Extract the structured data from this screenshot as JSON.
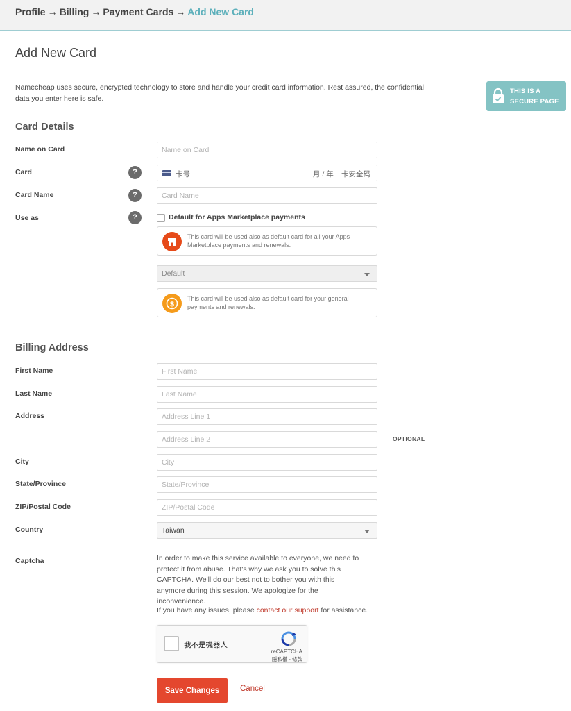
{
  "breadcrumb": {
    "items": [
      "Profile",
      "Billing",
      "Payment Cards"
    ],
    "current": "Add New Card",
    "separator": "→"
  },
  "page": {
    "title": "Add New Card",
    "intro": "Namecheap uses secure, encrypted technology to store and handle your credit card information. Rest assured, the confidential data you enter here is safe.",
    "secure_badge": {
      "line1": "THIS IS A",
      "line2": "SECURE PAGE",
      "icon": "lock-icon",
      "color": "#84c3c4"
    }
  },
  "card_details": {
    "title": "Card Details",
    "name_on_card": {
      "label": "Name on Card",
      "placeholder": "Name on Card"
    },
    "card": {
      "label": "Card",
      "help": "?",
      "number_placeholder": "卡号",
      "expiry_placeholder": "月 / 年",
      "cvc_placeholder": "卡安全码"
    },
    "card_name": {
      "label": "Card Name",
      "help": "?",
      "placeholder": "Card Name"
    },
    "use_as": {
      "label": "Use as",
      "help": "?",
      "checkbox_label": "Default for Apps Marketplace payments",
      "apps_info": "This card will be used also as default card for all your Apps Marketplace payments and renewals.",
      "default_select": "Default",
      "general_info": "This card will be used also as default card for your general payments and renewals."
    }
  },
  "billing_address": {
    "title": "Billing Address",
    "first_name": {
      "label": "First Name",
      "placeholder": "First Name"
    },
    "last_name": {
      "label": "Last Name",
      "placeholder": "Last Name"
    },
    "address": {
      "label": "Address",
      "line1_placeholder": "Address Line 1",
      "line2_placeholder": "Address Line 2",
      "optional": "OPTIONAL"
    },
    "city": {
      "label": "City",
      "placeholder": "City"
    },
    "state": {
      "label": "State/Province",
      "placeholder": "State/Province"
    },
    "zip": {
      "label": "ZIP/Postal Code",
      "placeholder": "ZIP/Postal Code"
    },
    "country": {
      "label": "Country",
      "value": "Taiwan"
    }
  },
  "captcha": {
    "label": "Captcha",
    "text": "In order to make this service available to everyone, we need to protect it from abuse. That's why we ask you to solve this CAPTCHA. We'll do our best not to bother you with this anymore during this session. We apologize for the inconvenience.",
    "issues_prefix": "If you have any issues, please ",
    "issues_link": "contact our support",
    "issues_suffix": " for assistance.",
    "widget": {
      "checkbox_label": "我不是機器人",
      "brand": "reCAPTCHA",
      "terms": "隱私權 - 條款"
    }
  },
  "actions": {
    "save": "Save Changes",
    "cancel": "Cancel"
  },
  "colors": {
    "accent": "#e4472e",
    "link": "#c0392b",
    "breadcrumb_current": "#5db0bb"
  }
}
